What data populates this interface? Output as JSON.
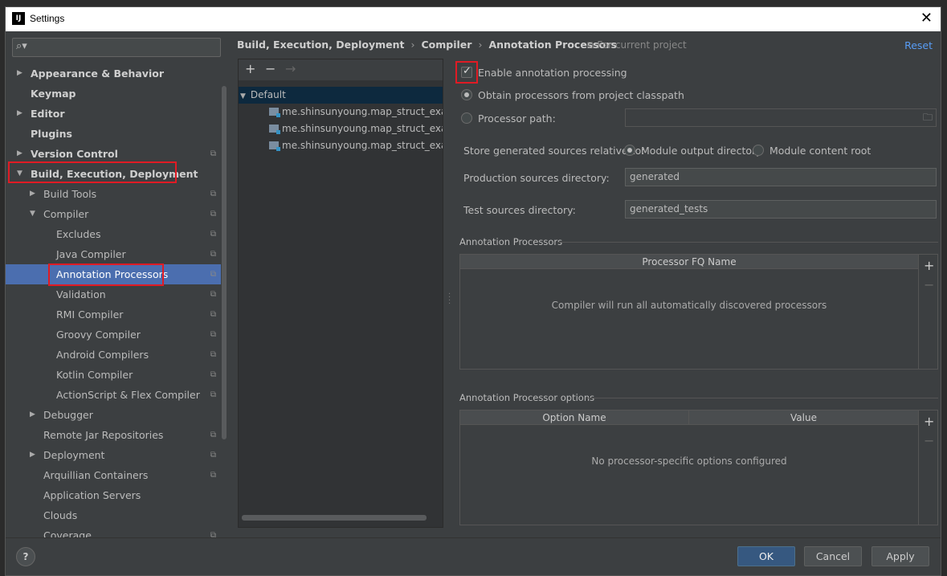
{
  "window": {
    "title": "Settings",
    "app_icon_label": "IJ"
  },
  "sidebar": {
    "search_placeholder": "",
    "items": [
      {
        "label": "Appearance & Behavior",
        "bold": true,
        "arrow": "▶",
        "shared": false
      },
      {
        "label": "Keymap",
        "bold": true,
        "arrow": "",
        "shared": false
      },
      {
        "label": "Editor",
        "bold": true,
        "arrow": "▶",
        "shared": false
      },
      {
        "label": "Plugins",
        "bold": true,
        "arrow": "",
        "shared": false
      },
      {
        "label": "Version Control",
        "bold": true,
        "arrow": "▶",
        "shared": true
      },
      {
        "label": "Build, Execution, Deployment",
        "bold": true,
        "arrow": "▼",
        "shared": false
      },
      {
        "label": "Build Tools",
        "bold": false,
        "arrow": "▶",
        "shared": true
      },
      {
        "label": "Compiler",
        "bold": false,
        "arrow": "▼",
        "shared": true
      },
      {
        "label": "Excludes",
        "bold": false,
        "arrow": "",
        "shared": true
      },
      {
        "label": "Java Compiler",
        "bold": false,
        "arrow": "",
        "shared": true
      },
      {
        "label": "Annotation Processors",
        "bold": false,
        "arrow": "",
        "shared": true,
        "selected": true
      },
      {
        "label": "Validation",
        "bold": false,
        "arrow": "",
        "shared": true
      },
      {
        "label": "RMI Compiler",
        "bold": false,
        "arrow": "",
        "shared": true
      },
      {
        "label": "Groovy Compiler",
        "bold": false,
        "arrow": "",
        "shared": true
      },
      {
        "label": "Android Compilers",
        "bold": false,
        "arrow": "",
        "shared": true
      },
      {
        "label": "Kotlin Compiler",
        "bold": false,
        "arrow": "",
        "shared": true
      },
      {
        "label": "ActionScript & Flex Compiler",
        "bold": false,
        "arrow": "",
        "shared": true
      },
      {
        "label": "Debugger",
        "bold": false,
        "arrow": "▶",
        "shared": false
      },
      {
        "label": "Remote Jar Repositories",
        "bold": false,
        "arrow": "",
        "shared": true
      },
      {
        "label": "Deployment",
        "bold": false,
        "arrow": "▶",
        "shared": true
      },
      {
        "label": "Arquillian Containers",
        "bold": false,
        "arrow": "",
        "shared": true
      },
      {
        "label": "Application Servers",
        "bold": false,
        "arrow": "",
        "shared": false
      },
      {
        "label": "Clouds",
        "bold": false,
        "arrow": "",
        "shared": false
      },
      {
        "label": "Coverage",
        "bold": false,
        "arrow": "",
        "shared": true
      }
    ]
  },
  "breadcrumb": {
    "parts": [
      "Build, Execution, Deployment",
      "Compiler",
      "Annotation Processors"
    ],
    "separator": "›",
    "scope": "For current project",
    "reset": "Reset"
  },
  "profiles": {
    "toolbar": {
      "add": "+",
      "remove": "−",
      "move": "→"
    },
    "default_label": "Default",
    "modules": [
      "me.shinsunyoung.map_struct_exam",
      "me.shinsunyoung.map_struct_exam.main",
      "me.shinsunyoung.map_struct_exam.test"
    ]
  },
  "settings": {
    "enable_processing": "Enable annotation processing",
    "enable_checked": true,
    "obtain_classpath": "Obtain processors from project classpath",
    "processor_path": "Processor path:",
    "processor_path_value": "",
    "store_label": "Store generated sources relative to:",
    "module_output": "Module output directory",
    "module_content": "Module content root",
    "production_label": "Production sources directory:",
    "production_value": "generated",
    "test_label": "Test sources directory:",
    "test_value": "generated_tests"
  },
  "processors_table": {
    "title": "Annotation Processors",
    "column": "Processor FQ Name",
    "empty": "Compiler will run all automatically discovered processors",
    "add": "+",
    "remove": "−"
  },
  "options_table": {
    "title": "Annotation Processor options",
    "col_name": "Option Name",
    "col_value": "Value",
    "empty": "No processor-specific options configured",
    "add": "+",
    "remove": "−"
  },
  "buttons": {
    "help": "?",
    "ok": "OK",
    "cancel": "Cancel",
    "apply": "Apply"
  },
  "colors": {
    "selection": "#4b6eaf",
    "link": "#589df6",
    "highlight": "#e01b24",
    "primary_button": "#365880"
  }
}
